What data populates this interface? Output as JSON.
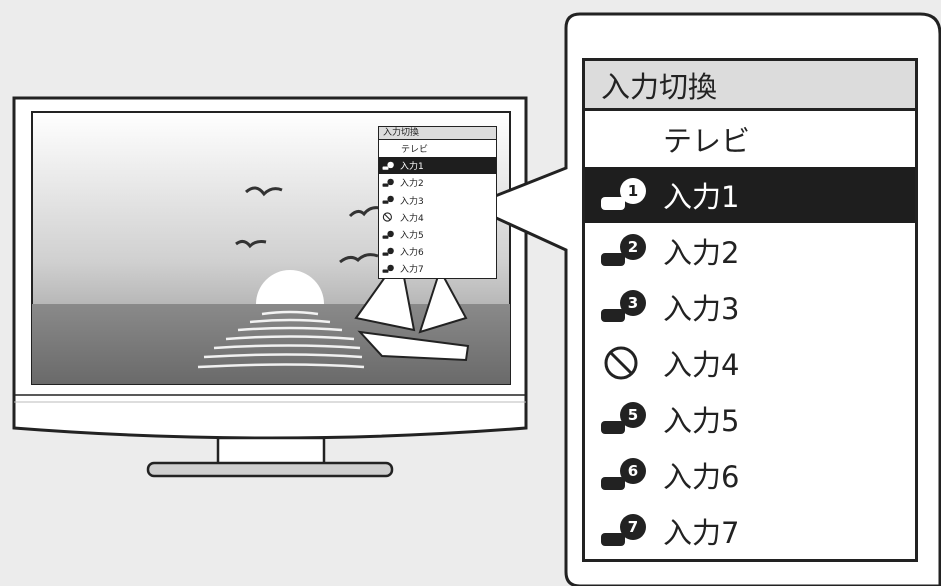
{
  "menu": {
    "title": "入力切換",
    "tv_label": "テレビ",
    "items": [
      {
        "label": "入力1",
        "icon": "input-connector-1-icon",
        "selected": true
      },
      {
        "label": "入力2",
        "icon": "input-connector-2-icon",
        "selected": false
      },
      {
        "label": "入力3",
        "icon": "input-connector-3-icon",
        "selected": false
      },
      {
        "label": "入力4",
        "icon": "prohibited-icon",
        "selected": false
      },
      {
        "label": "入力5",
        "icon": "input-connector-5-icon",
        "selected": false
      },
      {
        "label": "入力6",
        "icon": "input-connector-6-icon",
        "selected": false
      },
      {
        "label": "入力7",
        "icon": "input-connector-7-icon",
        "selected": false
      }
    ]
  },
  "colors": {
    "selected_bg": "#1e1e1e",
    "header_bg": "#dcdcdc",
    "background": "#ececec"
  }
}
